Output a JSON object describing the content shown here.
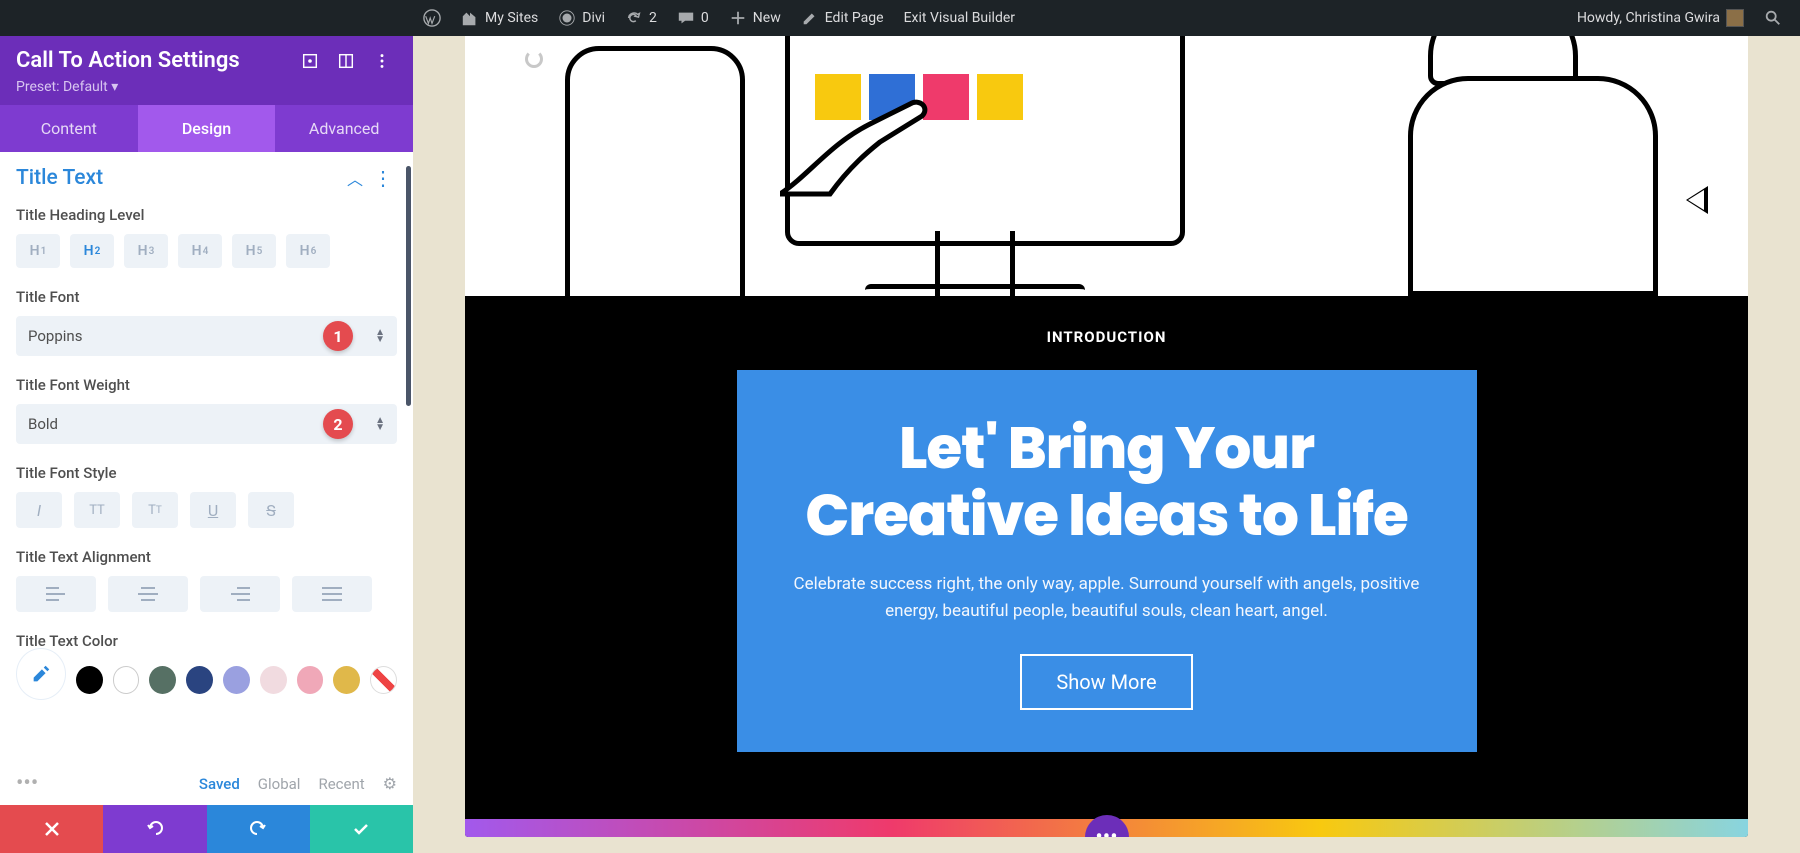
{
  "wp_bar": {
    "my_sites": "My Sites",
    "site_name": "Divi",
    "updates": "2",
    "comments": "0",
    "new": "New",
    "edit_page": "Edit Page",
    "exit_vb": "Exit Visual Builder",
    "howdy": "Howdy, Christina Gwira"
  },
  "panel": {
    "title": "Call To Action Settings",
    "preset": "Preset: Default ▾",
    "tabs": {
      "content": "Content",
      "design": "Design",
      "advanced": "Advanced"
    },
    "section": "Title Text",
    "heading_label": "Title Heading Level",
    "headings": [
      "H1",
      "H2",
      "H3",
      "H4",
      "H5",
      "H6"
    ],
    "heading_active": "H2",
    "font_label": "Title Font",
    "font_value": "Poppins",
    "weight_label": "Title Font Weight",
    "weight_value": "Bold",
    "style_label": "Title Font Style",
    "align_label": "Title Text Alignment",
    "color_label": "Title Text Color",
    "swatches": [
      "#000000",
      "#ffffff",
      "#567064",
      "#2a4480",
      "#9aa0e0",
      "#f1dbe0",
      "#f0a8b8",
      "#e0b84a"
    ],
    "footer_links": {
      "saved": "Saved",
      "global": "Global",
      "recent": "Recent"
    },
    "badge1": "1",
    "badge2": "2"
  },
  "preview": {
    "intro": "INTRODUCTION",
    "title": "Let' Bring Your Creative Ideas to Life",
    "desc": "Celebrate success right, the only way, apple. Surround yourself with angels, positive energy, beautiful people, beautiful souls, clean heart, angel.",
    "button": "Show More"
  }
}
